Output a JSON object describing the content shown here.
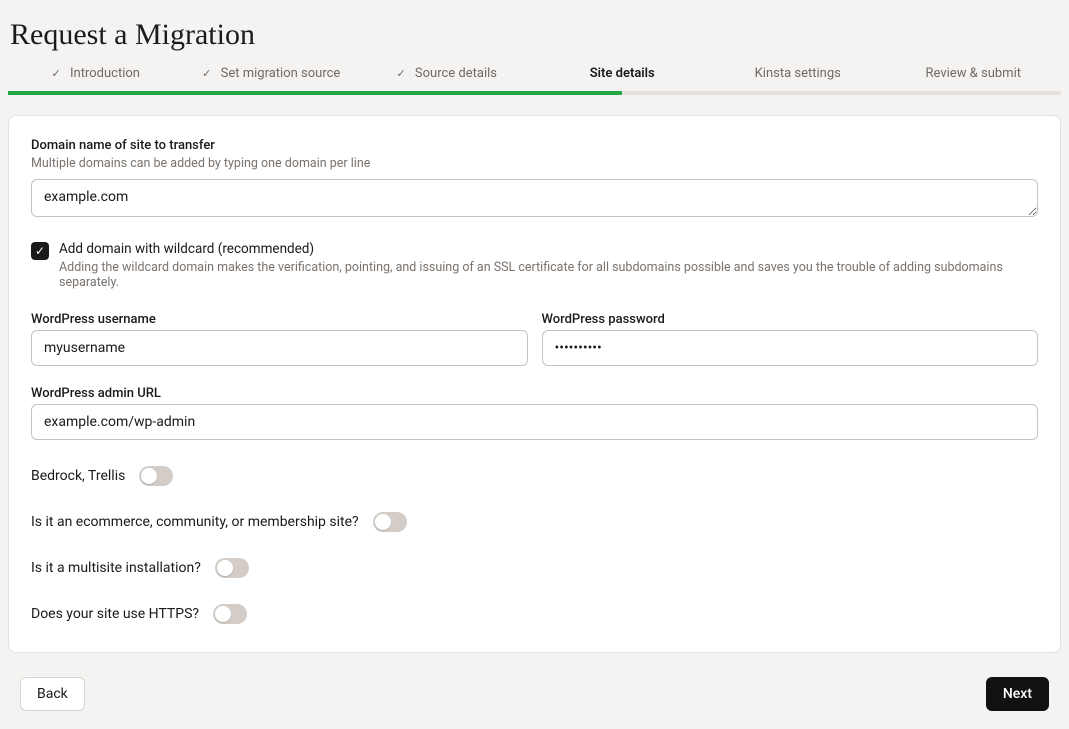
{
  "title": "Request a Migration",
  "steps": [
    {
      "label": "Introduction",
      "done": true,
      "current": false
    },
    {
      "label": "Set migration source",
      "done": true,
      "current": false
    },
    {
      "label": "Source details",
      "done": true,
      "current": false
    },
    {
      "label": "Site details",
      "done": false,
      "current": true
    },
    {
      "label": "Kinsta settings",
      "done": false,
      "current": false
    },
    {
      "label": "Review & submit",
      "done": false,
      "current": false
    }
  ],
  "domain": {
    "label": "Domain name of site to transfer",
    "sublabel": "Multiple domains can be added by typing one domain per line",
    "value": "example.com"
  },
  "wildcard": {
    "checked": true,
    "label": "Add domain with wildcard (recommended)",
    "help": "Adding the wildcard domain makes the verification, pointing, and issuing of an SSL certificate for all subdomains possible and saves you the trouble of adding subdomains separately."
  },
  "credentials": {
    "username_label": "WordPress username",
    "username_value": "myusername",
    "password_label": "WordPress password",
    "password_value": "••••••••••"
  },
  "admin_url": {
    "label": "WordPress admin URL",
    "value": "example.com/wp-admin"
  },
  "toggles": {
    "bedrock": {
      "label": "Bedrock, Trellis",
      "on": false
    },
    "ecommerce": {
      "label": "Is it an ecommerce, community, or membership site?",
      "on": false
    },
    "multisite": {
      "label": "Is it a multisite installation?",
      "on": false
    },
    "https": {
      "label": "Does your site use HTTPS?",
      "on": false
    }
  },
  "footer": {
    "back_label": "Back",
    "next_label": "Next"
  }
}
